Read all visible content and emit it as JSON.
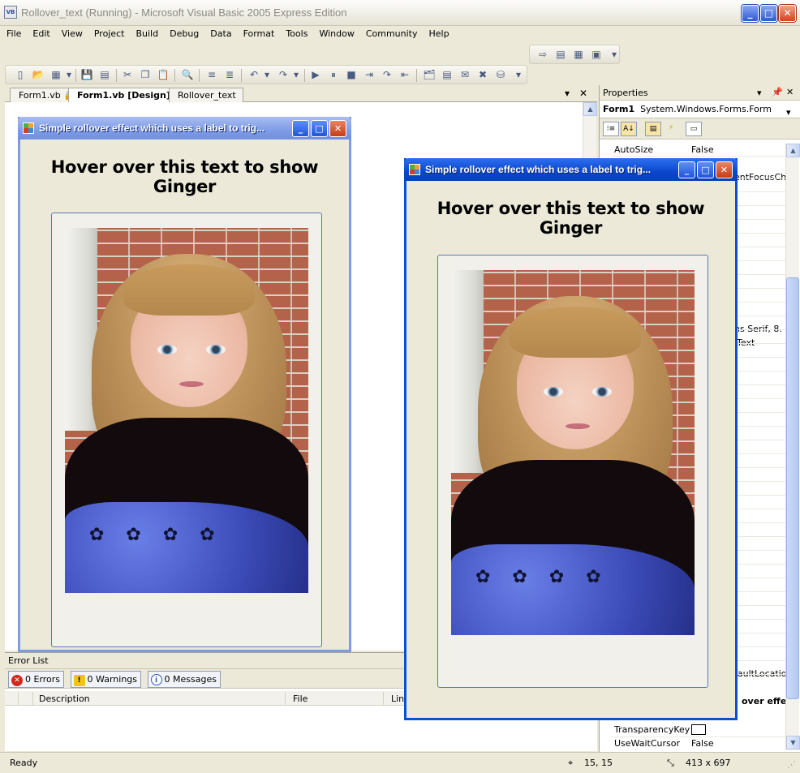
{
  "app": {
    "title": "Rollover_text (Running) - Microsoft Visual Basic 2005 Express Edition",
    "icon_text": "VB"
  },
  "window_controls": {
    "minimize": "_",
    "maximize": "□",
    "close": "✕"
  },
  "menu": [
    "File",
    "Edit",
    "View",
    "Project",
    "Build",
    "Debug",
    "Data",
    "Format",
    "Tools",
    "Window",
    "Community",
    "Help"
  ],
  "doc_tabs": [
    {
      "label": "Form1.vb",
      "active": false
    },
    {
      "label": "Form1.vb [Design]",
      "active": true
    },
    {
      "label": "Rollover_text",
      "active": false
    }
  ],
  "form": {
    "caption": "Simple rollover effect which uses a label to trig...",
    "heading": "Hover over this text to show Ginger"
  },
  "error_list": {
    "title": "Error List",
    "errors": "0 Errors",
    "warnings": "0 Warnings",
    "messages": "0 Messages",
    "columns": [
      "Description",
      "File",
      "Line"
    ]
  },
  "properties": {
    "title": "Properties",
    "object_name": "Form1",
    "object_type": "System.Windows.Forms.Form",
    "rows": [
      {
        "name": "AutoSize",
        "value": "False"
      },
      {
        "name": "",
        "value": "entFocusCha"
      },
      {
        "name": "",
        "value": "l"
      },
      {
        "name": "",
        "value": "ns Serif, 8."
      },
      {
        "name": "",
        "value": "lText"
      },
      {
        "name": "",
        "value": "faultLocatio"
      },
      {
        "name": "TransparencyKey",
        "value": ""
      },
      {
        "name": "UseWaitCursor",
        "value": "False"
      }
    ],
    "description_title": "over effe"
  },
  "status": {
    "left": "Ready",
    "position": "15, 15",
    "size": "413 x 697"
  }
}
